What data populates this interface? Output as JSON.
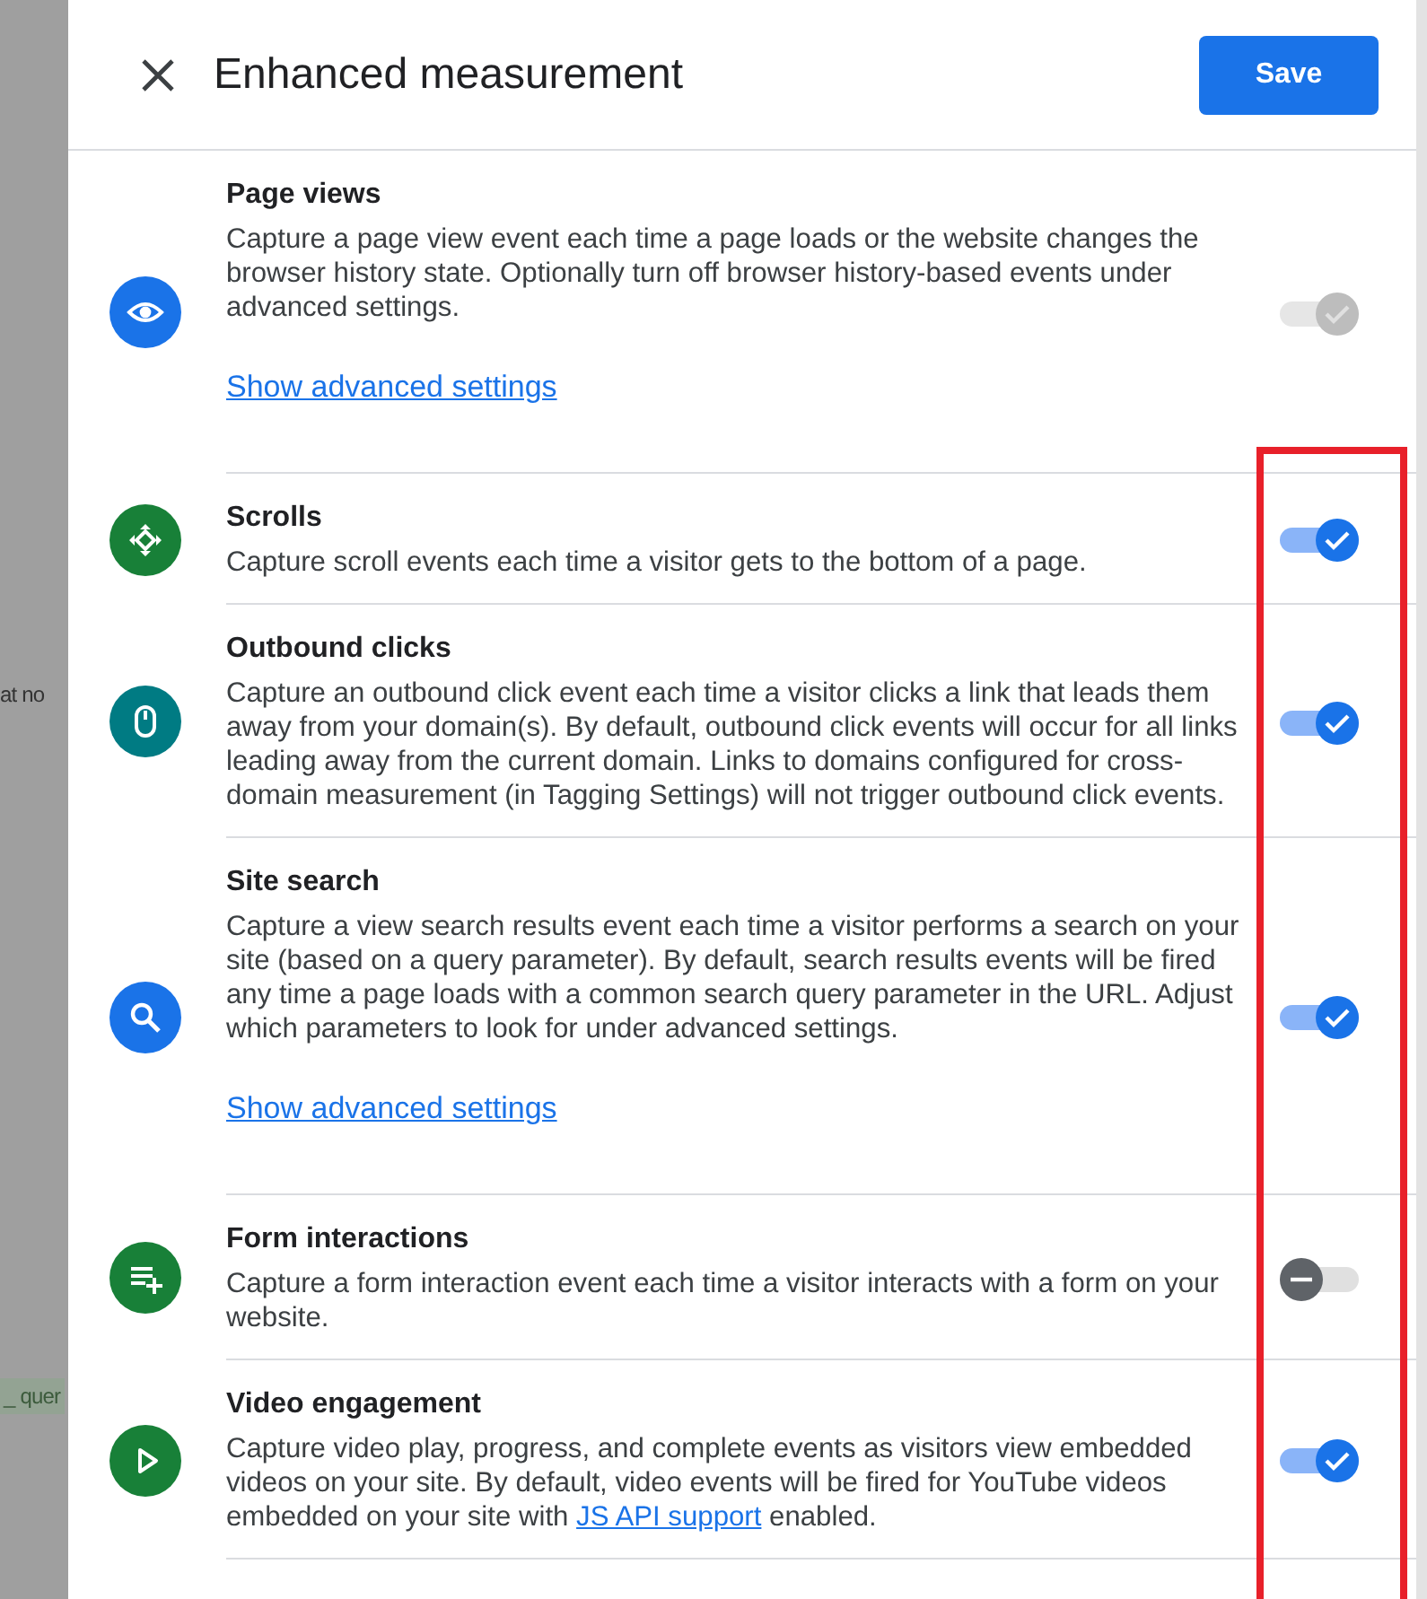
{
  "background": {
    "fragments": [
      {
        "text": "at no",
        "kind": "plain"
      },
      {
        "text": "_ quer",
        "kind": "chip"
      }
    ]
  },
  "panel": {
    "title": "Enhanced measurement",
    "save_label": "Save"
  },
  "items": [
    {
      "kind": "eye",
      "color": "#1a73e8",
      "title": "Page views",
      "description": "Capture a page view event each time a page loads or the website changes the browser history state. Optionally turn off browser history-based events under advanced settings.",
      "link": "Show advanced settings",
      "on": true,
      "disabled": true
    },
    {
      "kind": "scroll",
      "color": "#188038",
      "title": "Scrolls",
      "description": "Capture scroll events each time a visitor gets to the bottom of a page.",
      "on": true,
      "disabled": false
    },
    {
      "kind": "mouse",
      "color": "#007b83",
      "title": "Outbound clicks",
      "description": "Capture an outbound click event each time a visitor clicks a link that leads them away from your domain(s). By default, outbound click events will occur for all links leading away from the current domain. Links to domains configured for cross-domain measurement (in Tagging Settings) will not trigger outbound click events.",
      "on": true,
      "disabled": false
    },
    {
      "kind": "search",
      "color": "#1a73e8",
      "title": "Site search",
      "description": "Capture a view search results event each time a visitor performs a search on your site (based on a query parameter). By default, search results events will be fired any time a page loads with a common search query parameter in the URL. Adjust which parameters to look for under advanced settings.",
      "link": "Show advanced settings",
      "on": true,
      "disabled": false
    },
    {
      "kind": "form",
      "color": "#188038",
      "title": "Form interactions",
      "description": "Capture a form interaction event each time a visitor interacts with a form on your website.",
      "on": false,
      "disabled": false
    },
    {
      "kind": "play",
      "color": "#188038",
      "title": "Video engagement",
      "description": "Capture video play, progress, and complete events as visitors view embedded videos on your site. By default, video events will be fired for YouTube videos embedded on your site with ",
      "inline_link": "JS API support",
      "description_end": " enabled.",
      "on": true,
      "disabled": false
    }
  ],
  "highlight_frame": true
}
